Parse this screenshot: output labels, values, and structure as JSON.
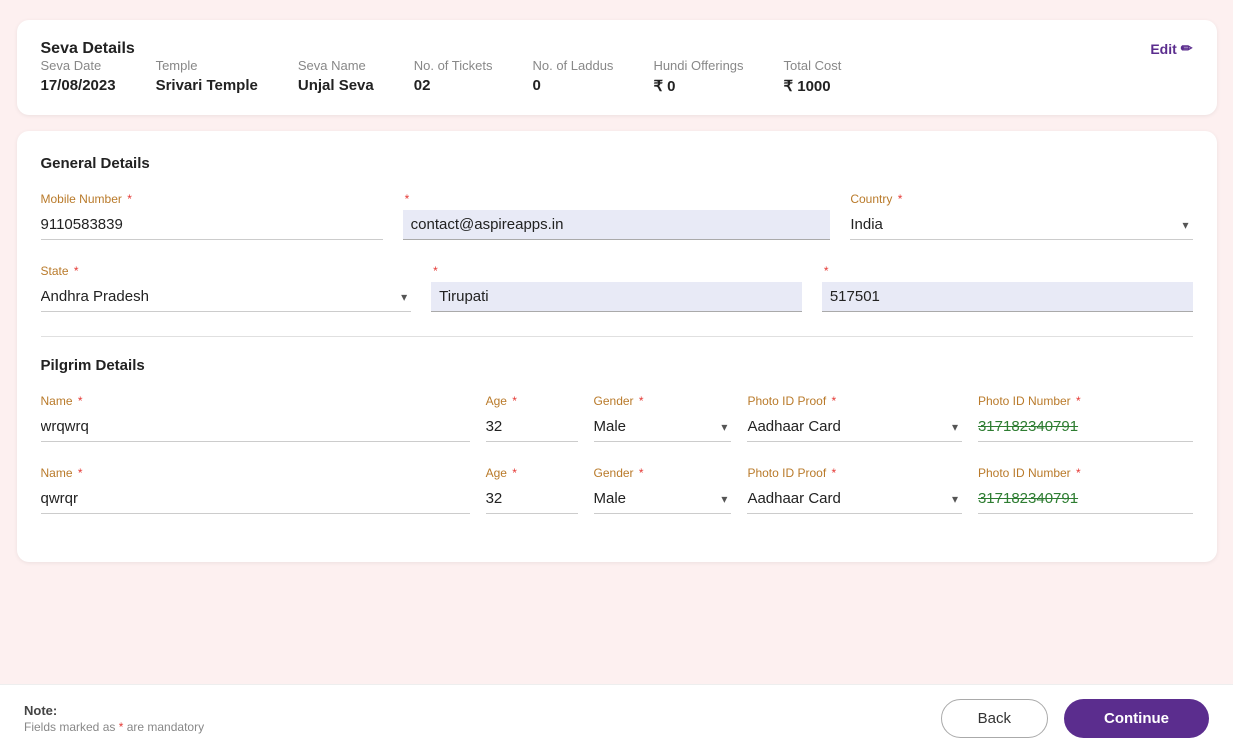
{
  "seva": {
    "title": "Seva Details",
    "edit_label": "Edit",
    "edit_icon": "✏",
    "fields": [
      {
        "label": "Seva Date",
        "value": "17/08/2023"
      },
      {
        "label": "Temple",
        "value": "Srivari Temple"
      },
      {
        "label": "Seva Name",
        "value": "Unjal Seva"
      },
      {
        "label": "No. of Tickets",
        "value": "02"
      },
      {
        "label": "No. of Laddus",
        "value": "0"
      },
      {
        "label": "Hundi Offerings",
        "value": "₹ 0"
      },
      {
        "label": "Total Cost",
        "value": "₹ 1000"
      }
    ]
  },
  "general": {
    "title": "General Details",
    "mobile_label": "Mobile Number",
    "mobile_value": "9110583839",
    "email_label": "",
    "email_value": "contact@aspireapps.in",
    "country_label": "Country",
    "country_value": "India",
    "state_label": "State",
    "state_value": "Andhra Pradesh",
    "city_label": "",
    "city_value": "Tirupati",
    "pincode_value": "517501"
  },
  "pilgrim": {
    "title": "Pilgrim Details",
    "name_label": "Name",
    "age_label": "Age",
    "gender_label": "Gender",
    "photo_proof_label": "Photo ID Proof",
    "photo_id_label": "Photo ID Number",
    "row1": {
      "name": "wrqwrq",
      "age": "32",
      "gender": "Male",
      "photo_proof": "Aadhaar Card",
      "photo_id": "317182340791"
    },
    "row2": {
      "name": "qwrqr",
      "age": "32",
      "gender": "Male",
      "photo_proof": "Aadhaar Card",
      "photo_id": "317182340791"
    }
  },
  "footer": {
    "note_label": "Note:",
    "note_text": "Fields marked as ",
    "note_star": "*",
    "note_suffix": " are mandatory",
    "back_label": "Back",
    "continue_label": "Continue"
  }
}
